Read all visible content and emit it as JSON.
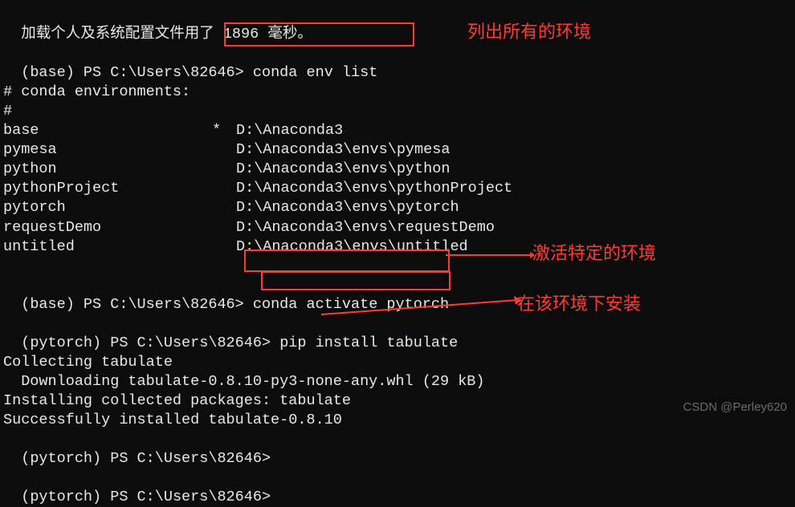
{
  "load_line": "加载个人及系统配置文件用了 1896 毫秒。",
  "prompts": {
    "base": "(base) PS C:\\Users\\82646>",
    "pytorch": "(pytorch) PS C:\\Users\\82646>"
  },
  "commands": {
    "env_list": "conda env list",
    "activate": "conda activate pytorch",
    "pip_install": "pip install tabulate"
  },
  "env_header": "# conda environments:",
  "env_hash": "#",
  "environments": [
    {
      "name": "base",
      "active": "*",
      "path": "D:\\Anaconda3"
    },
    {
      "name": "pymesa",
      "active": " ",
      "path": "D:\\Anaconda3\\envs\\pymesa"
    },
    {
      "name": "python",
      "active": " ",
      "path": "D:\\Anaconda3\\envs\\python"
    },
    {
      "name": "pythonProject",
      "active": " ",
      "path": "D:\\Anaconda3\\envs\\pythonProject"
    },
    {
      "name": "pytorch",
      "active": " ",
      "path": "D:\\Anaconda3\\envs\\pytorch"
    },
    {
      "name": "requestDemo",
      "active": " ",
      "path": "D:\\Anaconda3\\envs\\requestDemo"
    },
    {
      "name": "untitled",
      "active": " ",
      "path": "D:\\Anaconda3\\envs\\untitled"
    }
  ],
  "pip_output": {
    "collecting": "Collecting tabulate",
    "downloading": "  Downloading tabulate-0.8.10-py3-none-any.whl (29 kB)",
    "installing": "Installing collected packages: tabulate",
    "success": "Successfully installed tabulate-0.8.10"
  },
  "annotations": {
    "list_envs": "列出所有的环境",
    "activate_env": "激活特定的环境",
    "install_in_env": "在该环境下安装"
  },
  "watermark": "CSDN @Perley620"
}
